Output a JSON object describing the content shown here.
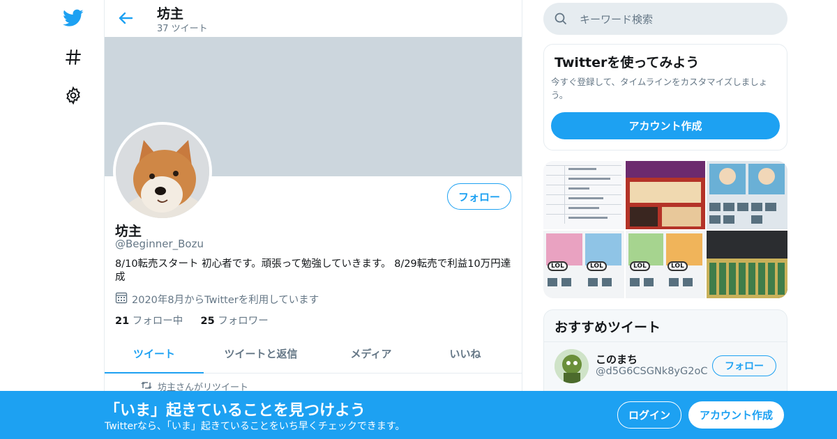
{
  "nav": {
    "items": [
      {
        "icon": "twitter-bird-icon",
        "label": "Twitter"
      },
      {
        "icon": "hashtag-icon",
        "label": "#"
      },
      {
        "icon": "gear-icon",
        "label": "Settings"
      }
    ]
  },
  "header": {
    "name": "坊主",
    "tweet_count": "37 ツイート"
  },
  "profile": {
    "follow_label": "フォロー",
    "name": "坊主",
    "handle": "@Beginner_Bozu",
    "bio": "8/10転売スタート 初心者です。頑張って勉強していきます。 8/29転売で利益10万円達成",
    "joined": "2020年8月からTwitterを利用しています",
    "following_count": "21",
    "following_label": "フォロー中",
    "followers_count": "25",
    "followers_label": "フォロワー"
  },
  "tabs": [
    {
      "label": "ツイート",
      "active": true
    },
    {
      "label": "ツイートと返信",
      "active": false
    },
    {
      "label": "メディア",
      "active": false
    },
    {
      "label": "いいね",
      "active": false
    }
  ],
  "timeline": {
    "retweet_notice": "坊主さんがリツイート"
  },
  "search": {
    "placeholder": "キーワード検索"
  },
  "try_card": {
    "title": "Twitterを使ってみよう",
    "description": "今すぐ登録して、タイムラインをカスタマイズしましょう。",
    "button": "アカウント作成"
  },
  "media_grid": {
    "labels": [
      "LOL",
      "LOL",
      "LOL",
      "LOL"
    ]
  },
  "recommended": {
    "title": "おすすめツイート",
    "user_name": "このまち",
    "user_handle": "@d5G6CSGNk8yG2oC",
    "follow_label": "フォロー"
  },
  "bottom_bar": {
    "title": "「いま」起きていることを見つけよう",
    "subtitle": "Twitterなら、「いま」起きていることをいち早くチェックできます。",
    "login": "ログイン",
    "signup": "アカウント作成"
  },
  "colors": {
    "accent": "#1da1f2",
    "banner": "#ccd6dd",
    "muted_text": "#657786",
    "border": "#e6ecf0"
  }
}
